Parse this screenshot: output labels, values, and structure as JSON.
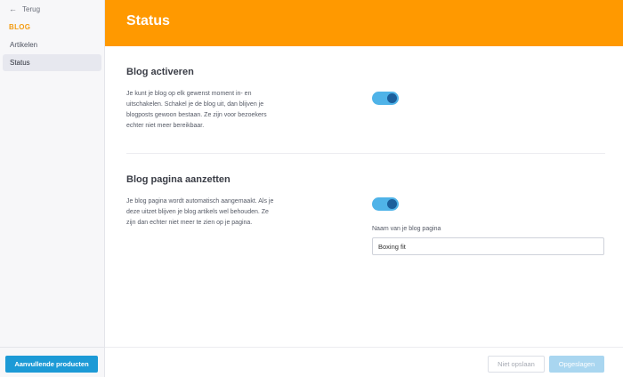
{
  "sidebar": {
    "back_label": "Terug",
    "section_label": "BLOG",
    "items": [
      {
        "label": "Artikelen",
        "active": false
      },
      {
        "label": "Status",
        "active": true
      }
    ],
    "footer_button": "Aanvullende producten"
  },
  "header": {
    "title": "Status"
  },
  "main": {
    "blog_activate": {
      "title": "Blog activeren",
      "description": "Je kunt je blog op elk gewenst moment in- en uitschakelen. Schakel je de blog uit, dan blijven je blogposts gewoon bestaan. Ze zijn voor bezoekers echter niet meer bereikbaar.",
      "toggle_on": true
    },
    "blog_page": {
      "title": "Blog pagina aanzetten",
      "description": "Je blog pagina wordt automatisch aangemaakt. Als je deze uitzet blijven je blog artikels wel behouden. Ze zijn dan echter niet meer te zien op je pagina.",
      "toggle_on": true,
      "name_label": "Naam van je blog pagina",
      "name_value": "Boxing fit"
    }
  },
  "footer": {
    "cancel_label": "Niet opslaan",
    "save_label": "Opgeslagen"
  },
  "colors": {
    "accent": "#ff9900",
    "primary_button": "#1c9ad6",
    "toggle_track": "#4fb3e8",
    "toggle_knob": "#1b5f9c"
  }
}
